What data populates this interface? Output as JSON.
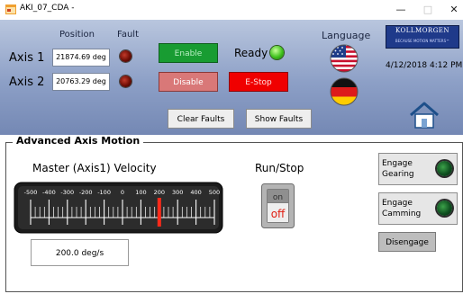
{
  "window": {
    "title": "AKI_07_CDA -",
    "minimize_glyph": "—",
    "maximize_glyph": "□",
    "close_glyph": "✕"
  },
  "header": {
    "position_label": "Position",
    "fault_label": "Fault",
    "language_label": "Language"
  },
  "axes": [
    {
      "label": "Axis 1",
      "position": "21874.69 deg",
      "fault_lamp": "dark-red"
    },
    {
      "label": "Axis 2",
      "position": "20763.29 deg",
      "fault_lamp": "dark-red"
    }
  ],
  "controls": {
    "enable_label": "Enable",
    "disable_label": "Disable",
    "estop_label": "E-Stop",
    "ready_label": "Ready",
    "ready_lamp": "green",
    "clear_faults_label": "Clear Faults",
    "show_faults_label": "Show Faults"
  },
  "languages": [
    "us-flag-icon",
    "german-flag-icon"
  ],
  "brand": {
    "name": "KOLLMORGEN",
    "tagline": "BECAUSE MOTION MATTERS™"
  },
  "datetime": "4/12/2018 4:12 PM",
  "advanced": {
    "section_title": "Advanced Axis Motion",
    "velocity_label": "Master (Axis1) Velocity",
    "gauge_ticks": [
      "-500",
      "-400",
      "-300",
      "-200",
      "-100",
      "0",
      "100",
      "200",
      "300",
      "400",
      "500"
    ],
    "gauge_min": -500,
    "gauge_max": 500,
    "gauge_value": 200,
    "velocity_display": "200.0 deg/s",
    "runstop_label": "Run/Stop",
    "switch_on_text": "on",
    "switch_off_text": "off",
    "engage_gearing_label": "Engage Gearing",
    "engage_camming_label": "Engage Camming",
    "disengage_label": "Disengage"
  },
  "colors": {
    "enable": "#189c32",
    "disable": "#d97878",
    "estop": "#f00000",
    "ready_lamp": "#3fc21d",
    "needle": "#ff2a1a"
  }
}
